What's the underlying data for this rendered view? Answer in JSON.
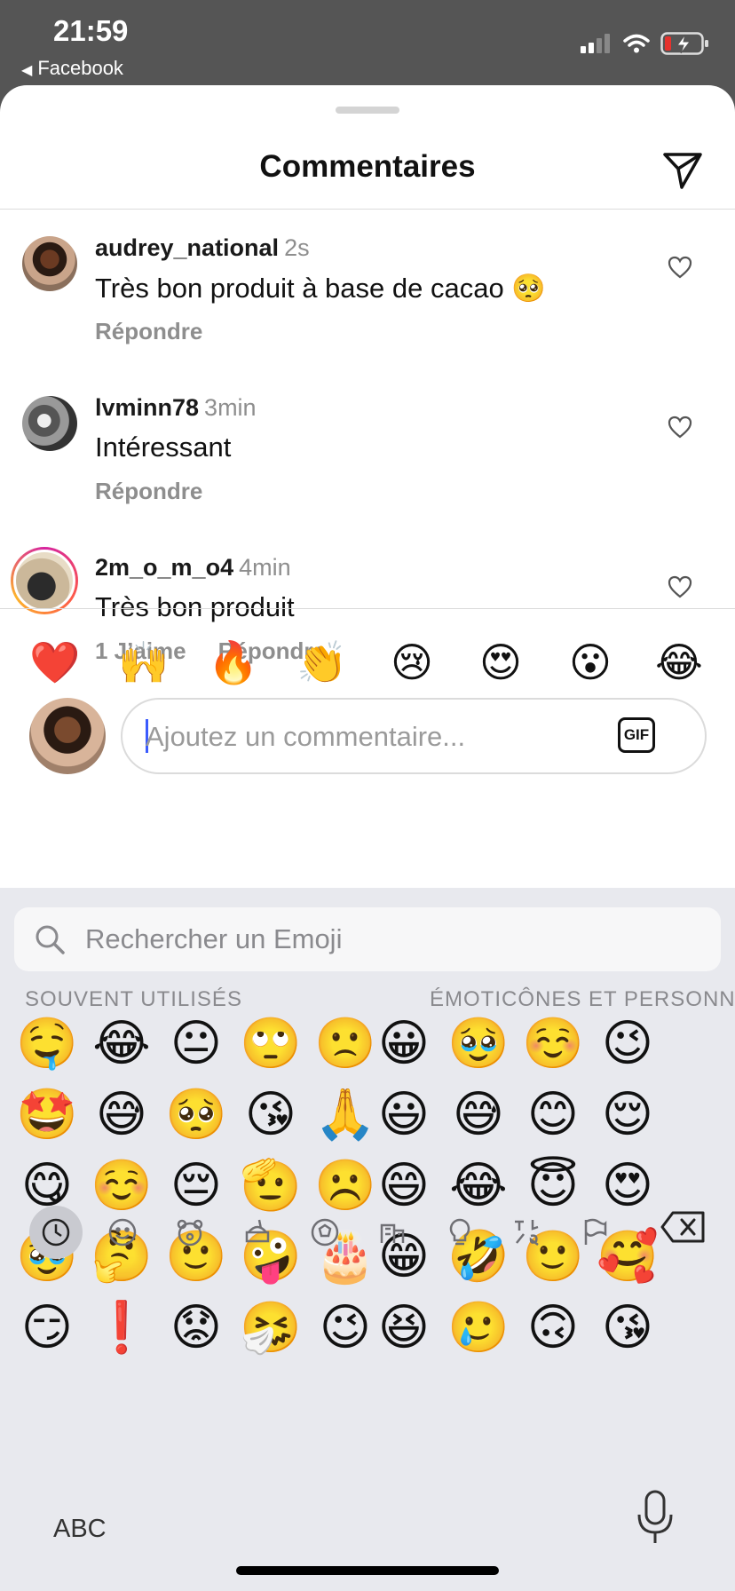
{
  "status_bar": {
    "time": "21:59",
    "back_app": "Facebook"
  },
  "sheet": {
    "title": "Commentaires"
  },
  "comments": [
    {
      "user": "audrey_national",
      "time": "2s",
      "text": "Très bon produit à base de cacao 🥺",
      "likes": "",
      "reply": "Répondre"
    },
    {
      "user": "lvminn78",
      "time": "3min",
      "text": "Intéressant",
      "likes": "",
      "reply": "Répondre"
    },
    {
      "user": "2m_o_m_o4",
      "time": "4min",
      "text": "Très bon produit",
      "likes": "1 J’aime",
      "reply": "Répondre"
    }
  ],
  "quick_reactions": [
    "❤️",
    "🙌",
    "🔥",
    "👏",
    "😢",
    "😍",
    "😮",
    "😂"
  ],
  "comment_input": {
    "placeholder": "Ajoutez un commentaire...",
    "gif_label": "GIF"
  },
  "emoji_keyboard": {
    "search_placeholder": "Rechercher un Emoji",
    "sections": [
      {
        "label": "SOUVENT UTILISÉS",
        "columns": [
          [
            "🤤",
            "🤩",
            "😋",
            "🥹",
            "😏"
          ],
          [
            "😂",
            "😅",
            "☺️",
            "🤔",
            "❗"
          ],
          [
            "😐",
            "🥺",
            "😔",
            "🙂",
            "😟"
          ],
          [
            "🙄",
            "😘",
            "🫡",
            "🤪",
            "🤧"
          ],
          [
            "🙁",
            "🙏",
            "☹️",
            "🎂",
            "😉"
          ]
        ]
      },
      {
        "label": "ÉMOTICÔNES ET PERSONNES",
        "columns": [
          [
            "😀",
            "😃",
            "😄",
            "😁",
            "😆"
          ],
          [
            "🥹",
            "😅",
            "😂",
            "🤣",
            "🥲"
          ],
          [
            "☺️",
            "😊",
            "😇",
            "🙂",
            "🙃"
          ],
          [
            "😉",
            "😌",
            "😍",
            "🥰",
            "😘"
          ]
        ]
      }
    ],
    "abc_label": "ABC"
  },
  "colors": {
    "status_bar_bg": "#555555",
    "keyboard_bg": "#e8e9ee",
    "secondary_text": "#8e8e8e",
    "caret": "#3b5bfd",
    "battery_red": "#e5322d"
  }
}
